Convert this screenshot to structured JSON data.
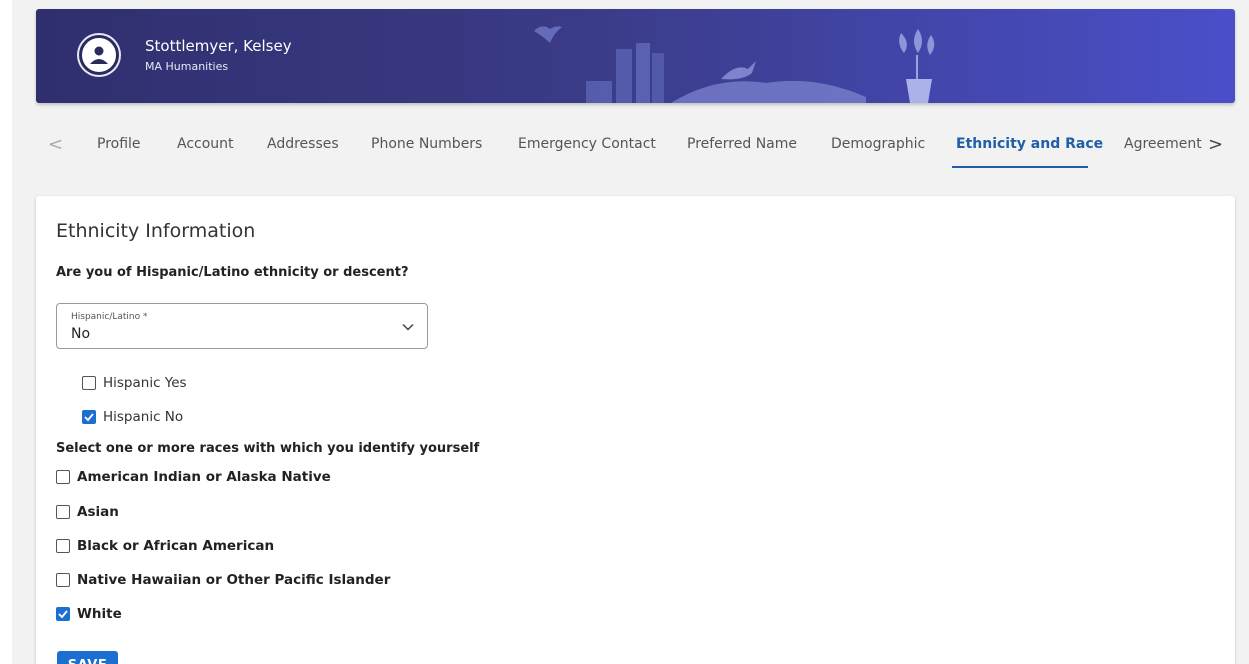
{
  "header": {
    "user_name": "Stottlemyer, Kelsey",
    "program": "MA Humanities"
  },
  "tabs": [
    {
      "label": "Profile",
      "active": false
    },
    {
      "label": "Account",
      "active": false
    },
    {
      "label": "Addresses",
      "active": false
    },
    {
      "label": "Phone Numbers",
      "active": false
    },
    {
      "label": "Emergency Contact",
      "active": false
    },
    {
      "label": "Preferred Name",
      "active": false
    },
    {
      "label": "Demographic",
      "active": false
    },
    {
      "label": "Ethnicity and Race",
      "active": true
    },
    {
      "label": "Agreement",
      "active": false
    }
  ],
  "ethnicity": {
    "title": "Ethnicity Information",
    "question": "Are you of Hispanic/Latino ethnicity or descent?",
    "select": {
      "label": "Hispanic/Latino *",
      "value": "No"
    },
    "options": [
      {
        "label": "Hispanic Yes",
        "checked": false
      },
      {
        "label": "Hispanic No",
        "checked": true
      }
    ]
  },
  "race": {
    "question": "Select one or more races with which you identify yourself",
    "options": [
      {
        "label": "American Indian or Alaska Native",
        "checked": false
      },
      {
        "label": "Asian",
        "checked": false
      },
      {
        "label": "Black or African American",
        "checked": false
      },
      {
        "label": "Native Hawaiian or Other Pacific Islander",
        "checked": false
      },
      {
        "label": "White",
        "checked": true
      }
    ]
  },
  "actions": {
    "save_label": "SAVE"
  },
  "colors": {
    "accent": "#1a6fd1",
    "tab_active": "#1f5fa8",
    "banner_start": "#2f2f6e",
    "banner_end": "#4a4fc9"
  },
  "icons": {
    "avatar": "account-circle-icon",
    "tab_prev": "chevron-left-icon",
    "tab_next": "chevron-right-icon",
    "select": "chevron-down-icon",
    "checkbox_checked": "check-icon"
  }
}
